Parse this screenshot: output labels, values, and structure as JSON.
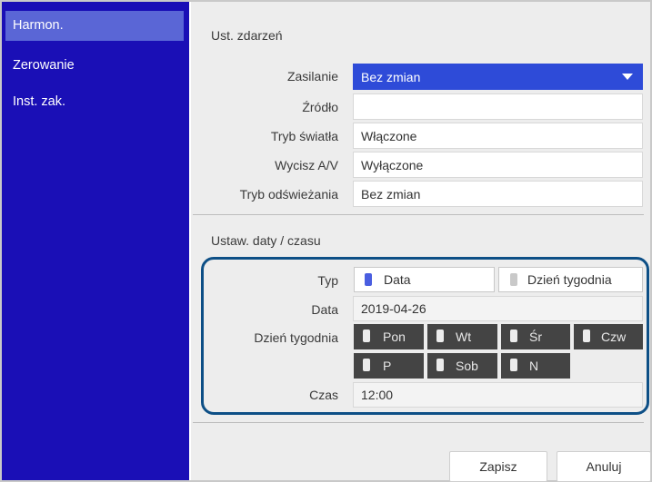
{
  "sidebar": {
    "items": [
      {
        "label": "Harmon.",
        "selected": true
      },
      {
        "label": "Zerowanie",
        "selected": false
      },
      {
        "label": "Inst. zak.",
        "selected": false
      }
    ]
  },
  "events": {
    "title": "Ust. zdarzeń",
    "rows": [
      {
        "label": "Zasilanie",
        "value": "Bez zmian",
        "selected": true
      },
      {
        "label": "Źródło",
        "value": ""
      },
      {
        "label": "Tryb światła",
        "value": "Włączone"
      },
      {
        "label": "Wycisz A/V",
        "value": "Wyłączone"
      },
      {
        "label": "Tryb odświeżania",
        "value": "Bez zmian"
      }
    ]
  },
  "datetime": {
    "title": "Ustaw. daty / czasu",
    "type_label": "Typ",
    "type_options": [
      {
        "label": "Data",
        "checked": true
      },
      {
        "label": "Dzień tygodnia",
        "checked": false
      }
    ],
    "date_label": "Data",
    "date_value": "2019-04-26",
    "weekday_label": "Dzień tygodnia",
    "days": [
      "Pon",
      "Wt",
      "Śr",
      "Czw",
      "P",
      "Sob",
      "N"
    ],
    "time_label": "Czas",
    "time_value": "12:00"
  },
  "footer": {
    "save_label": "Zapisz",
    "cancel_label": "Anuluj"
  },
  "colors": {
    "sidebar_bg": "#1a0fb6",
    "sidebar_selected": "#5a66d6",
    "selected_field": "#2e4bd8",
    "day_button": "#444444",
    "highlight_outline": "#0d4f86",
    "radio_checked": "#4a5ee0",
    "radio_unchecked": "#c9c9c9"
  },
  "icons": {
    "dropdown": "chevron-down-icon",
    "radio": "radio-indicator-icon",
    "day_toggle": "day-toggle-icon"
  }
}
